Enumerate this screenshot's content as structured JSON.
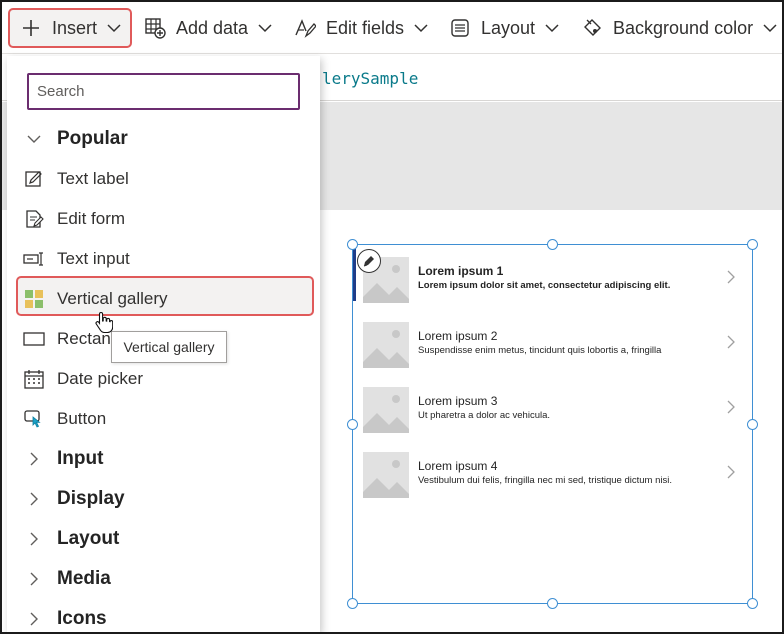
{
  "toolbar": {
    "items": [
      {
        "label": "Insert",
        "icon": "plus-icon"
      },
      {
        "label": "Add data",
        "icon": "table-add-icon"
      },
      {
        "label": "Edit fields",
        "icon": "edit-fields-icon"
      },
      {
        "label": "Layout",
        "icon": "layout-icon"
      },
      {
        "label": "Background color",
        "icon": "paint-bucket-icon"
      }
    ]
  },
  "formula": {
    "value": "lerySample"
  },
  "insert_panel": {
    "search_placeholder": "Search",
    "items": [
      {
        "label": "Popular",
        "type": "category",
        "expanded": true
      },
      {
        "label": "Text label",
        "icon": "text-label-icon"
      },
      {
        "label": "Edit form",
        "icon": "edit-form-icon"
      },
      {
        "label": "Text input",
        "icon": "text-input-icon"
      },
      {
        "label": "Vertical gallery",
        "icon": "vertical-gallery-icon",
        "highlighted": true
      },
      {
        "label": "Rectan",
        "icon": "rectangle-icon"
      },
      {
        "label": "Date picker",
        "icon": "date-picker-icon"
      },
      {
        "label": "Button",
        "icon": "button-icon"
      },
      {
        "label": "Input",
        "type": "category"
      },
      {
        "label": "Display",
        "type": "category"
      },
      {
        "label": "Layout",
        "type": "category"
      },
      {
        "label": "Media",
        "type": "category"
      },
      {
        "label": "Icons",
        "type": "category"
      }
    ]
  },
  "tooltip": {
    "text": "Vertical gallery"
  },
  "gallery": {
    "items": [
      {
        "title": "Lorem ipsum 1",
        "subtitle": "Lorem ipsum dolor sit amet, consectetur adipiscing elit."
      },
      {
        "title": "Lorem ipsum 2",
        "subtitle": "Suspendisse enim metus, tincidunt quis lobortis a, fringilla"
      },
      {
        "title": "Lorem ipsum 3",
        "subtitle": "Ut pharetra a dolor ac vehicula."
      },
      {
        "title": "Lorem ipsum 4",
        "subtitle": "Vestibulum dui felis, fringilla nec mi sed, tristique dictum nisi."
      }
    ]
  },
  "colors": {
    "highlight_border": "#e05a5a",
    "search_border": "#6b2d6f",
    "selection_blue": "#3f8fd3",
    "formula_text": "#0a7a8a"
  }
}
